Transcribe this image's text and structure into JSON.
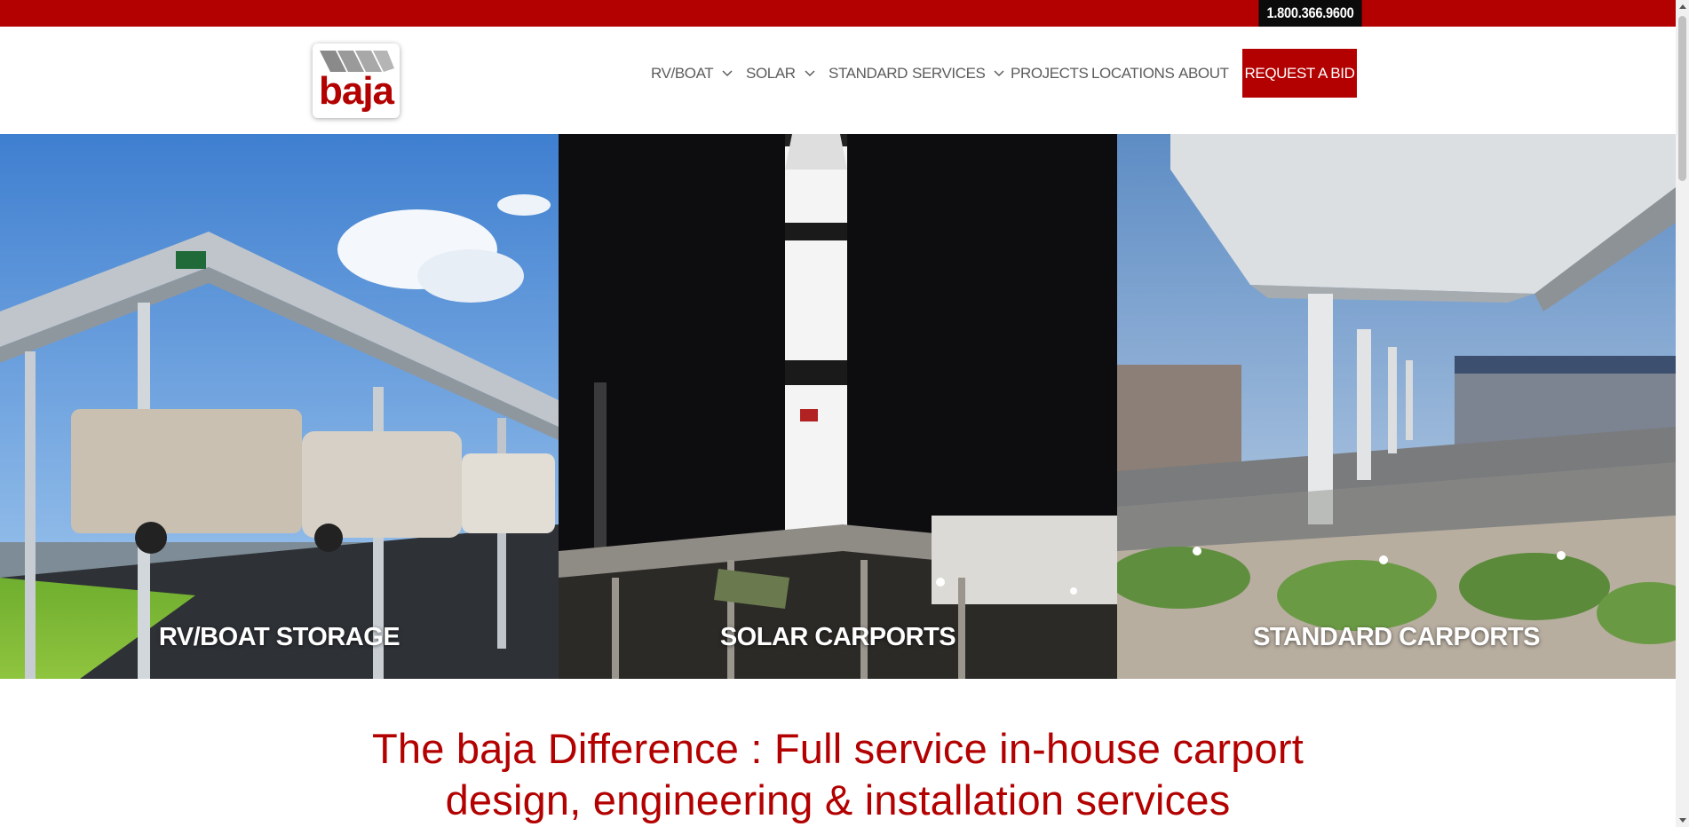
{
  "topbar": {
    "phone": "1.800.366.9600"
  },
  "logo": {
    "text": "baja"
  },
  "nav": {
    "items": [
      {
        "label": "RV/BOAT",
        "dropdown": true
      },
      {
        "label": "SOLAR",
        "dropdown": true
      },
      {
        "label": "STANDARD",
        "dropdown": false
      },
      {
        "label": "SERVICES",
        "dropdown": true
      },
      {
        "label": "PROJECTS",
        "dropdown": false
      },
      {
        "label": "LOCATIONS",
        "dropdown": false
      },
      {
        "label": "ABOUT",
        "dropdown": false
      }
    ],
    "cta": "REQUEST A BID"
  },
  "panels": [
    {
      "label": "RV/BOAT STORAGE",
      "image": "rv-carport-photo"
    },
    {
      "label": "SOLAR CARPORTS",
      "image": "rocket-solar-carport-photo"
    },
    {
      "label": "STANDARD CARPORTS",
      "image": "parking-carport-photo"
    }
  ],
  "headline": {
    "line1": "The baja Difference : Full service in-house carport",
    "line2": "design, engineering & installation services"
  },
  "colors": {
    "brand": "#b30000",
    "phone_bg": "#0b0b0b",
    "nav_text": "#5c5c5c"
  }
}
